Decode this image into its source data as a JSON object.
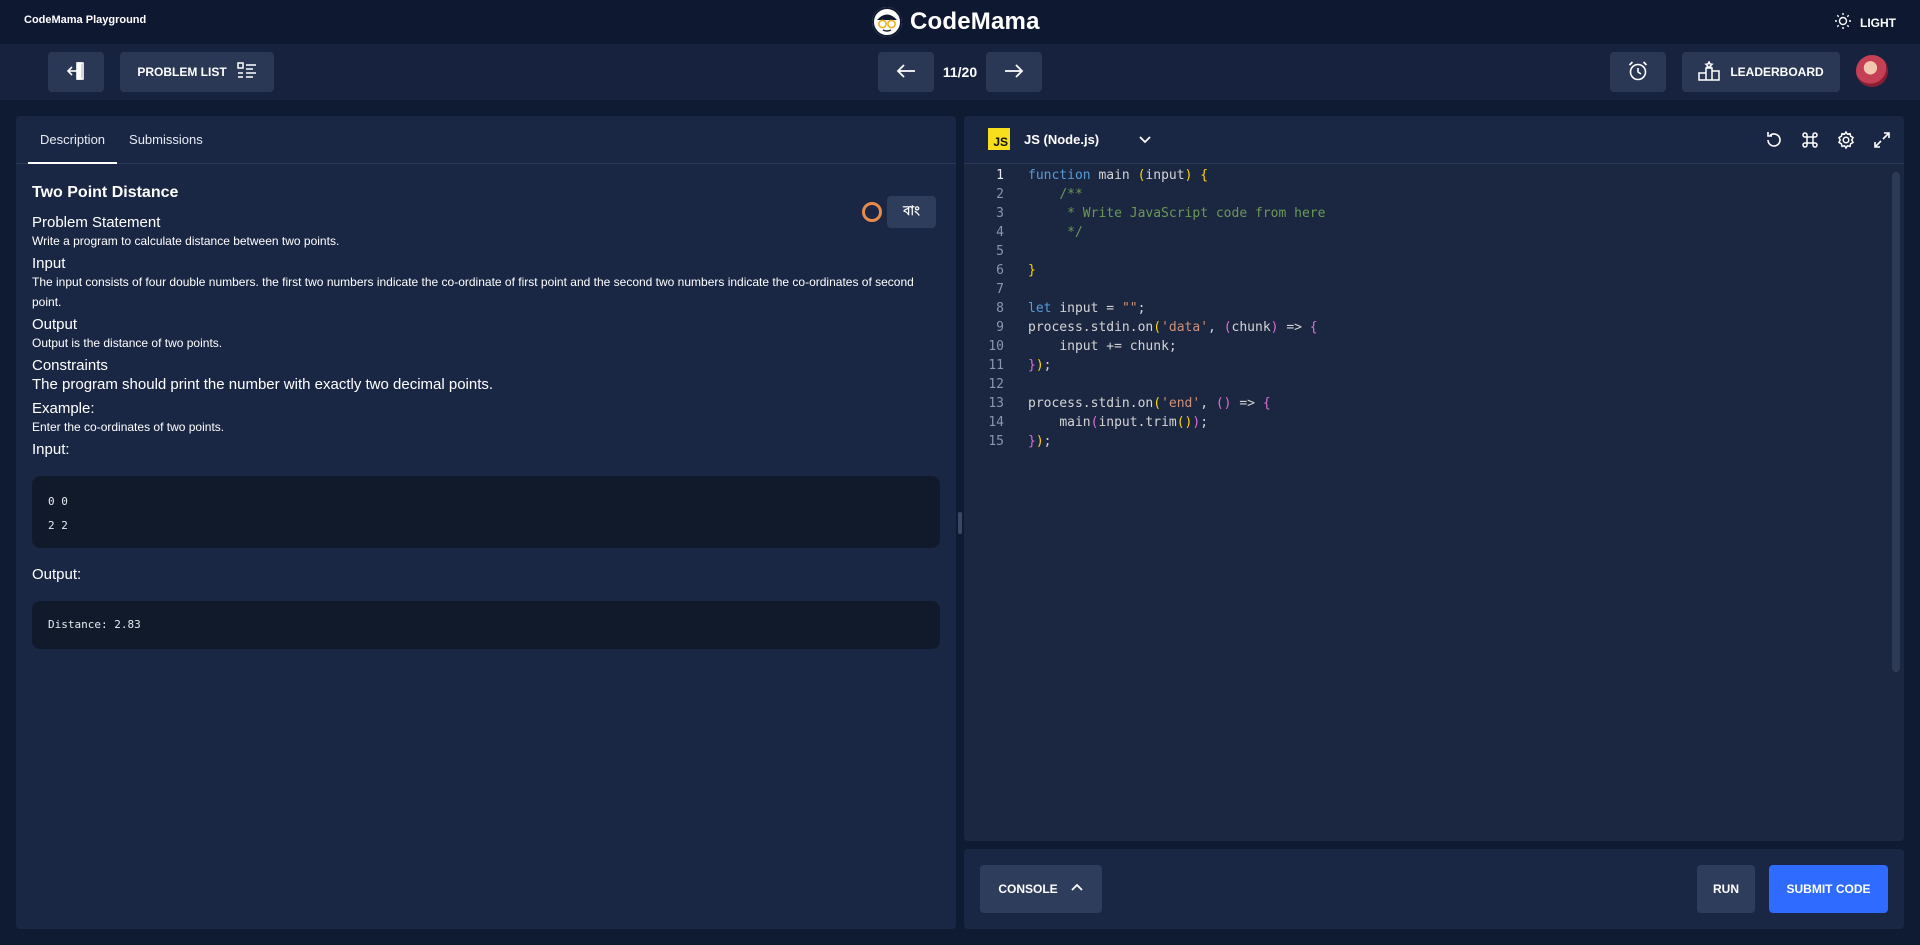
{
  "app": {
    "name": "CodeMama Playground",
    "logo_text": "CodeMama",
    "theme_label": "LIGHT"
  },
  "toolbar": {
    "problem_list_label": "PROBLEM LIST",
    "counter": "11/20",
    "leaderboard_label": "LEADERBOARD"
  },
  "tabs": [
    {
      "label": "Description",
      "active": true
    },
    {
      "label": "Submissions",
      "active": false
    }
  ],
  "problem": {
    "title": "Two Point Distance",
    "lang_toggle": "বাং",
    "statement_heading": "Problem Statement",
    "statement": "Write a program to calculate distance between two points.",
    "input_heading": "Input",
    "input_text": "The input consists of four double numbers. the first two numbers indicate the co-ordinate of first point and the second two numbers indicate the co-ordinates of second point.",
    "output_heading": "Output",
    "output_text": "Output is the distance of two points.",
    "constraints_heading": "Constraints",
    "constraints_text": "The program should print the number with exactly two decimal points.",
    "example_heading": "Example:",
    "example_text": "Enter the co-ordinates of two points.",
    "example_input_label": "Input:",
    "example_input_lines": [
      "0 0",
      "2 2"
    ],
    "example_output_label": "Output:",
    "example_output_lines": [
      "Distance: 2.83"
    ]
  },
  "editor": {
    "language_badge": "JS",
    "language_name": "JS (Node.js)",
    "line_numbers": [
      "1",
      "2",
      "3",
      "4",
      "5",
      "6",
      "7",
      "8",
      "9",
      "10",
      "11",
      "12",
      "13",
      "14",
      "15"
    ]
  },
  "bottom": {
    "console_label": "CONSOLE",
    "run_label": "RUN",
    "submit_label": "SUBMIT CODE"
  },
  "colors": {
    "accent": "#2f6bff",
    "background": "#0f1a33",
    "panel": "#1a2744",
    "js_yellow": "#f7df1e",
    "status_ring": "#e88a4a"
  }
}
